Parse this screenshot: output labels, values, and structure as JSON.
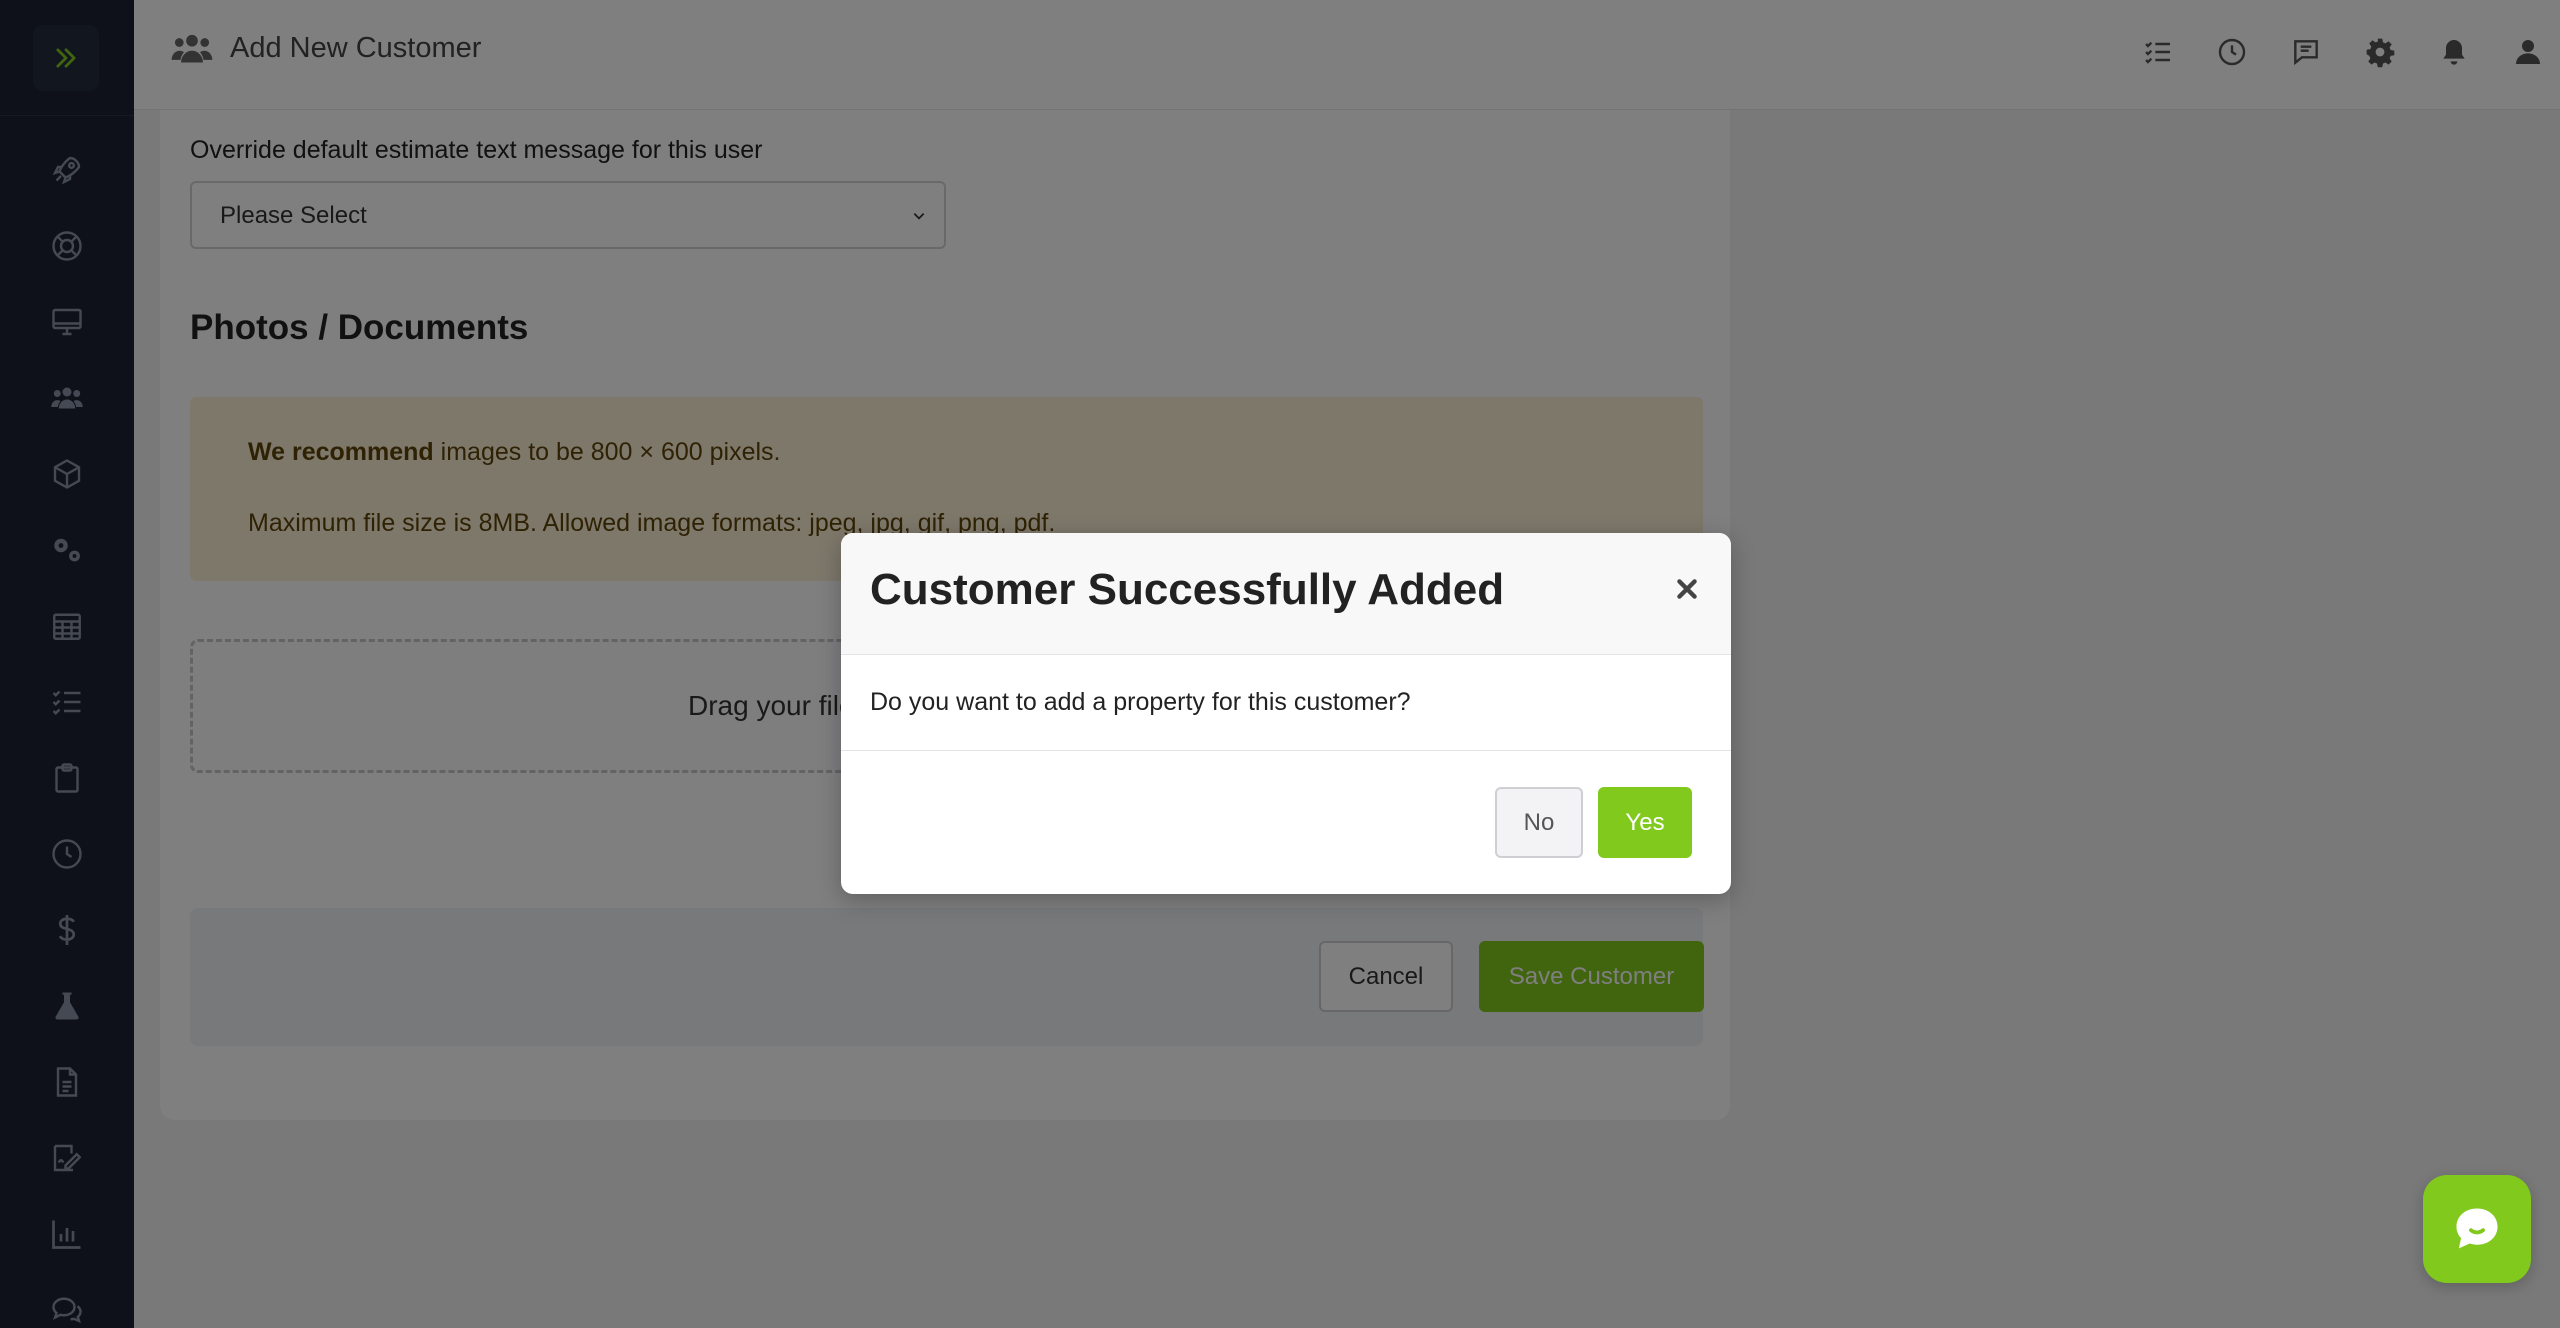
{
  "header": {
    "title": "Add New Customer",
    "title_icon": "users-icon",
    "actions": [
      "tasks-icon",
      "clock-icon",
      "messages-icon",
      "gear-icon",
      "bell-icon",
      "user-icon"
    ]
  },
  "sidebar": {
    "toggle_icon": "double-chevron-right-icon",
    "items": [
      {
        "icon": "rocket-icon"
      },
      {
        "icon": "lifebuoy-icon"
      },
      {
        "icon": "monitor-icon"
      },
      {
        "icon": "users-icon"
      },
      {
        "icon": "box-icon"
      },
      {
        "icon": "cogs-icon"
      },
      {
        "icon": "calendar-icon"
      },
      {
        "icon": "checklist-icon"
      },
      {
        "icon": "clipboard-icon"
      },
      {
        "icon": "clock-icon"
      },
      {
        "icon": "dollar-icon"
      },
      {
        "icon": "flask-icon"
      },
      {
        "icon": "file-icon"
      },
      {
        "icon": "signature-icon"
      },
      {
        "icon": "bar-chart-icon"
      },
      {
        "icon": "chat-icon"
      }
    ]
  },
  "form": {
    "override_label": "Override default estimate text message for this user",
    "select_value": "Please Select",
    "photos_title": "Photos / Documents",
    "alert": {
      "strong": "We recommend",
      "line1_rest": " images to be 800 × 600 pixels.",
      "line2": "Maximum file size is 8MB. Allowed image formats: jpeg, jpg, gif, png, pdf."
    },
    "dropzone_text": "Drag your files here or click to upload",
    "cancel_label": "Cancel",
    "save_label": "Save Customer"
  },
  "modal": {
    "title": "Customer Successfully Added",
    "body": "Do you want to add a property for this customer?",
    "no_label": "No",
    "yes_label": "Yes"
  },
  "colors": {
    "accent": "#82c91e",
    "sidebar_bg": "#1c2333",
    "alert_bg": "#fdf0d7",
    "alert_text": "#5e4409"
  }
}
